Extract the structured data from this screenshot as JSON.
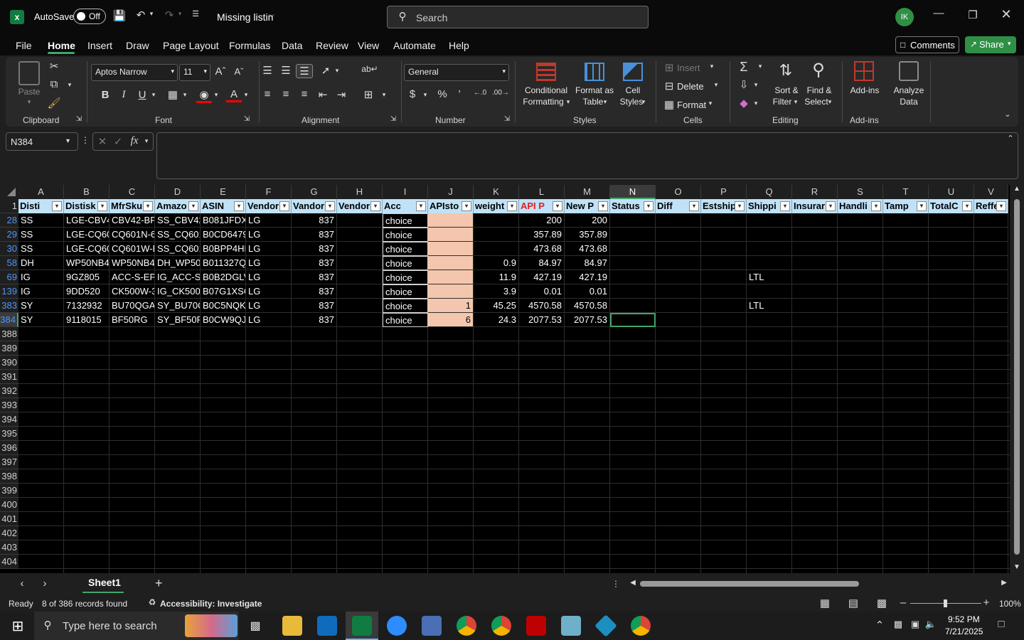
{
  "titlebar": {
    "autosave_label": "AutoSave",
    "autosave_state": "Off",
    "filename": "Missing listin",
    "search_placeholder": "Search",
    "avatar_initials": "IK"
  },
  "menu": {
    "items": [
      "File",
      "Home",
      "Insert",
      "Draw",
      "Page Layout",
      "Formulas",
      "Data",
      "Review",
      "View",
      "Automate",
      "Help"
    ],
    "active": "Home",
    "comments_label": "Comments",
    "share_label": "Share"
  },
  "ribbon": {
    "clipboard": {
      "paste": "Paste",
      "label": "Clipboard"
    },
    "font": {
      "name": "Aptos Narrow",
      "size": "11",
      "label": "Font",
      "bold": "B",
      "italic": "I",
      "underline": "U"
    },
    "alignment": {
      "label": "Alignment"
    },
    "number": {
      "format": "General",
      "label": "Number"
    },
    "styles": {
      "conditional_line1": "Conditional",
      "conditional_line2": "Formatting",
      "format_table_line1": "Format as",
      "format_table_line2": "Table",
      "cell_styles_line1": "Cell",
      "cell_styles_line2": "Styles",
      "label": "Styles"
    },
    "cells": {
      "insert": "Insert",
      "delete": "Delete",
      "format": "Format",
      "label": "Cells"
    },
    "editing": {
      "sort_line1": "Sort &",
      "sort_line2": "Filter",
      "find_line1": "Find &",
      "find_line2": "Select",
      "label": "Editing"
    },
    "addins": {
      "addins": "Add-ins",
      "analyze_line1": "Analyze",
      "analyze_line2": "Data",
      "label": "Add-ins"
    }
  },
  "formula_bar": {
    "name_box": "N384",
    "fx": "fx",
    "formula": ""
  },
  "columns": [
    "A",
    "B",
    "C",
    "D",
    "E",
    "F",
    "G",
    "H",
    "I",
    "J",
    "K",
    "L",
    "M",
    "N",
    "O",
    "P",
    "Q",
    "R",
    "S",
    "T",
    "U",
    "V"
  ],
  "selected_column": "N",
  "header_row": {
    "row_number": "1",
    "cells": [
      "Disti",
      "Distisk",
      "MfrSku",
      "Amazo",
      "ASIN",
      "Vendor",
      "Vandor",
      "Vendor",
      "Acc",
      "APIsto",
      "weight",
      "API P",
      "New P",
      "Status",
      "Diff",
      "Estship",
      "Shippi",
      "Insurar",
      "Handli",
      "Tamp",
      "TotalC",
      "Reffee"
    ]
  },
  "rows": [
    {
      "n": "28",
      "A": "SS",
      "B": "LGE-CBV4",
      "C": "CBV42-BP",
      "D": "SS_CBV42-",
      "E": "B081JFDXS",
      "F": "LG",
      "G": "837",
      "I": "choice",
      "J": "",
      "K": "",
      "L": "200",
      "M": "200",
      "Q": ""
    },
    {
      "n": "29",
      "A": "SS",
      "B": "LGE-CQ60",
      "C": "CQ601N-6",
      "D": "SS_CQ601",
      "E": "B0CD6479",
      "F": "LG",
      "G": "837",
      "I": "choice",
      "J": "",
      "K": "",
      "L": "357.89",
      "M": "357.89",
      "Q": ""
    },
    {
      "n": "30",
      "A": "SS",
      "B": "LGE-CQ60",
      "C": "CQ601W-E",
      "D": "SS_CQ601",
      "E": "B0BPP4HL",
      "F": "LG",
      "G": "837",
      "I": "choice",
      "J": "",
      "K": "",
      "L": "473.68",
      "M": "473.68",
      "Q": ""
    },
    {
      "n": "58",
      "A": "DH",
      "B": "WP50NB4",
      "C": "WP50NB4",
      "D": "DH_WP50I",
      "E": "B011327Q",
      "F": "LG",
      "G": "837",
      "I": "choice",
      "J": "",
      "K": "0.9",
      "L": "84.97",
      "M": "84.97",
      "Q": ""
    },
    {
      "n": "69",
      "A": "IG",
      "B": "9GZ805",
      "C": "ACC-S-EP5",
      "D": "IG_ACC-S-",
      "E": "B0B2DGLV",
      "F": "LG",
      "G": "837",
      "I": "choice",
      "J": "",
      "K": "11.9",
      "L": "427.19",
      "M": "427.19",
      "Q": "LTL"
    },
    {
      "n": "139",
      "A": "IG",
      "B": "9DD520",
      "C": "CK500W-3",
      "D": "IG_CK500",
      "E": "B07G1XSC",
      "F": "LG",
      "G": "837",
      "I": "choice",
      "J": "",
      "K": "3.9",
      "L": "0.01",
      "M": "0.01",
      "Q": ""
    },
    {
      "n": "383",
      "A": "SY",
      "B": "7132932",
      "C": "BU70QGA",
      "D": "SY_BU70Q",
      "E": "B0C5NQKI",
      "F": "LG",
      "G": "837",
      "I": "choice",
      "J": "1",
      "K": "45.25",
      "L": "4570.58",
      "M": "4570.58",
      "Q": "LTL"
    },
    {
      "n": "384",
      "A": "SY",
      "B": "9118015",
      "C": "BF50RG",
      "D": "SY_BF50R",
      "E": "B0CW9QJ",
      "F": "LG",
      "G": "837",
      "I": "choice",
      "J": "6",
      "K": "24.3",
      "L": "2077.53",
      "M": "2077.53",
      "Q": ""
    }
  ],
  "empty_rows": [
    "388",
    "389",
    "390",
    "391",
    "392",
    "393",
    "394",
    "395",
    "396",
    "397",
    "398",
    "399",
    "400",
    "401",
    "402",
    "403",
    "404"
  ],
  "sheet_tabs": {
    "active": "Sheet1",
    "add": "+"
  },
  "status": {
    "ready": "Ready",
    "records": "8 of 386 records found",
    "accessibility": "Accessibility: Investigate",
    "zoom": "100%"
  },
  "taskbar": {
    "search_placeholder": "Type here to search",
    "time": "9:52 PM",
    "date": "7/21/2025"
  },
  "colors": {
    "accent": "#3fa66a",
    "header_fill": "#c0e2f8",
    "peach": "#f4c6ad",
    "filtered_row": "#4e95ff"
  }
}
